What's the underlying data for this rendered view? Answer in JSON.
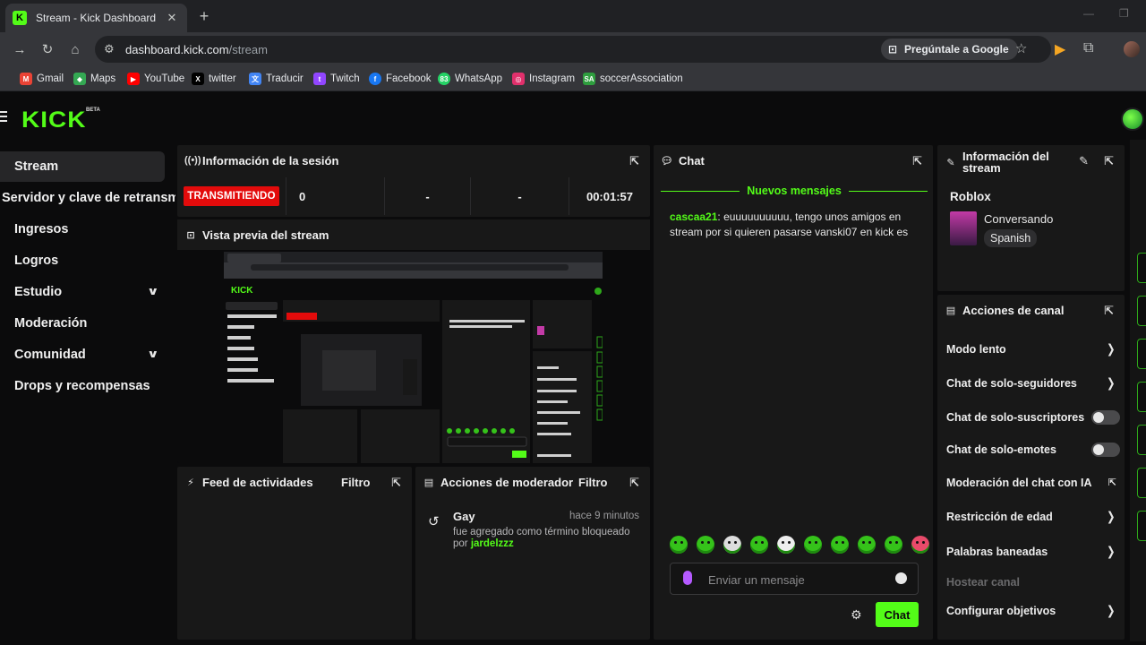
{
  "browser": {
    "tab_title": "Stream - Kick Dashboard",
    "favicon_letter": "K",
    "tab_close": "✕",
    "new_tab": "+",
    "url_host": "dashboard.kick.com",
    "url_path": "/stream",
    "ask_google": "Pregúntale a Google",
    "bookmarks": [
      {
        "label": "Gmail",
        "color": "#ea4335"
      },
      {
        "label": "Maps",
        "color": "#34a853"
      },
      {
        "label": "YouTube",
        "color": "#ff0000"
      },
      {
        "label": "twitter",
        "color": "#000000"
      },
      {
        "label": "Traducir",
        "color": "#4285f4"
      },
      {
        "label": "Twitch",
        "color": "#9146ff"
      },
      {
        "label": "Facebook",
        "color": "#1877f2"
      },
      {
        "label": "WhatsApp",
        "color": "#25d366"
      },
      {
        "label": "Instagram",
        "color": "#e1306c"
      },
      {
        "label": "soccerAssociation",
        "color": "#2e9e3e"
      }
    ]
  },
  "kick": {
    "logo": "KICK",
    "beta": "BETA",
    "accent": "#53fc18"
  },
  "sidebar": {
    "items": [
      {
        "label": "Stream",
        "active": true,
        "expandable": false
      },
      {
        "label": "Servidor y clave de retransmisión",
        "active": false,
        "expandable": false
      },
      {
        "label": "Ingresos",
        "active": false,
        "expandable": false
      },
      {
        "label": "Logros",
        "active": false,
        "expandable": false
      },
      {
        "label": "Estudio",
        "active": false,
        "expandable": true
      },
      {
        "label": "Moderación",
        "active": false,
        "expandable": false
      },
      {
        "label": "Comunidad",
        "active": false,
        "expandable": true
      },
      {
        "label": "Drops y recompensas",
        "active": false,
        "expandable": false
      }
    ]
  },
  "session": {
    "title": "Información de la sesión",
    "status": "TRANSMITIENDO",
    "viewers": "0",
    "stat2": "-",
    "stat3": "-",
    "duration": "00:01:57"
  },
  "preview": {
    "title": "Vista previa del stream"
  },
  "activity": {
    "title": "Feed de actividades",
    "filter": "Filtro"
  },
  "moderator": {
    "title": "Acciones de moderador",
    "filter": "Filtro",
    "entries": [
      {
        "term": "Gay",
        "time": "hace 9 minutos",
        "desc": "fue agregado como término bloqueado por",
        "by": "jardelzzz"
      }
    ]
  },
  "chat": {
    "title": "Chat",
    "new_messages": "Nuevos mensajes",
    "messages": [
      {
        "user": "cascaa21",
        "text": " euuuuuuuuuu, tengo unos amigos en stream por si quieren pasarse vanski07 en kick es"
      }
    ],
    "placeholder": "Enviar un mensaje",
    "send_label": "Chat",
    "emotes": [
      "emote-1",
      "emote-2",
      "emote-3",
      "emote-4",
      "emote-5",
      "emote-6",
      "emote-7",
      "emote-8",
      "emote-9",
      "emote-10"
    ]
  },
  "stream_info": {
    "title": "Información del stream",
    "category": "Roblox",
    "stream_title": "Conversando",
    "language": "Spanish"
  },
  "channel_actions": {
    "title": "Acciones de canal",
    "items": [
      {
        "label": "Modo lento",
        "kind": "arrow"
      },
      {
        "label": "Chat de solo-seguidores",
        "kind": "arrow"
      },
      {
        "label": "Chat de solo-suscriptores",
        "kind": "toggle"
      },
      {
        "label": "Chat de solo-emotes",
        "kind": "toggle"
      },
      {
        "label": "Moderación del chat con IA",
        "kind": "external"
      },
      {
        "label": "Restricción de edad",
        "kind": "arrow"
      },
      {
        "label": "Palabras baneadas",
        "kind": "arrow"
      },
      {
        "label": "Hostear canal",
        "kind": "disabled"
      },
      {
        "label": "Configurar objetivos",
        "kind": "arrow"
      }
    ]
  }
}
